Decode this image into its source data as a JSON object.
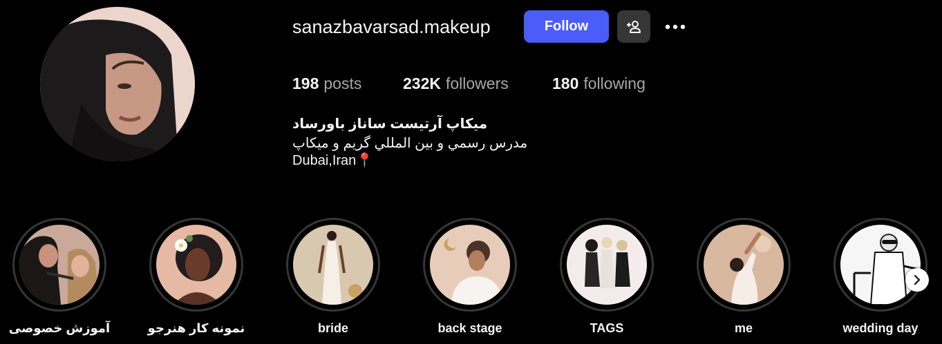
{
  "profile": {
    "username": "sanazbavarsad.makeup",
    "avatar_icon": "profile-photo-woman-black-headscarf",
    "follow_label": "Follow",
    "suggest_icon": "person-add-icon",
    "options_icon": "more-horizontal-icon"
  },
  "stats": {
    "posts": {
      "value": "198",
      "label": "posts"
    },
    "followers": {
      "value": "232K",
      "label": "followers"
    },
    "following": {
      "value": "180",
      "label": "following"
    }
  },
  "bio": {
    "name": "میکاپ آرتیست ساناز باورساد",
    "line1": "مدرس رسمي و بين المللي گريم و ميکاپ",
    "location": "Dubai,Iran📍"
  },
  "highlights": [
    {
      "label": "آموزش خصوصی",
      "icon": "photo-makeup-artist-with-client"
    },
    {
      "label": "نمونه کار هنرجو",
      "icon": "illustration-woman-with-flowers"
    },
    {
      "label": "bride",
      "icon": "illustration-woman-white-dress"
    },
    {
      "label": "back stage",
      "icon": "illustration-woman-with-moon"
    },
    {
      "label": "TAGS",
      "icon": "illustration-three-women"
    },
    {
      "label": "me",
      "icon": "illustration-woman-stretching"
    },
    {
      "label": "wedding day",
      "icon": "illustration-bride-sunglasses"
    }
  ],
  "next_icon": "chevron-right-icon",
  "colors": {
    "background": "#000000",
    "accent": "#4a5df9",
    "secondary_button": "#363636",
    "text": "#f5f5f5",
    "muted_text": "#a8a8a8"
  }
}
